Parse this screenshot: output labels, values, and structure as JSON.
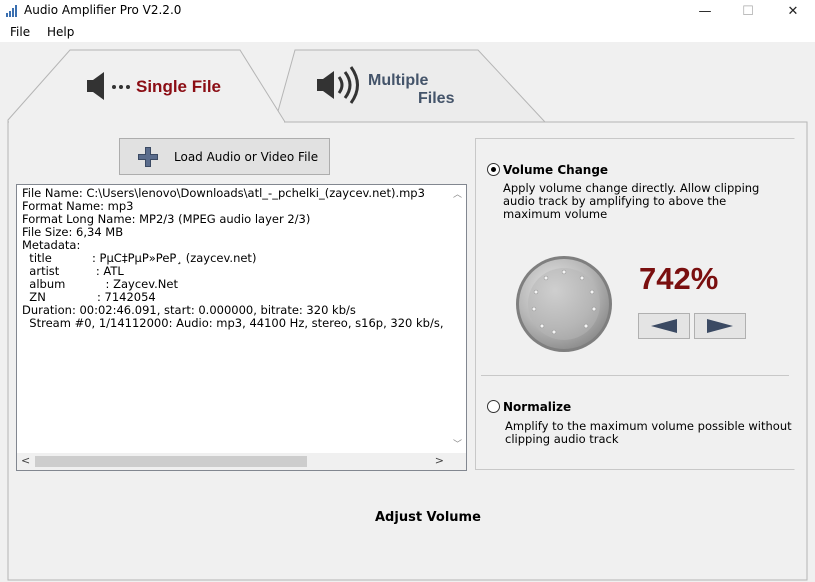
{
  "window": {
    "title": "Audio Amplifier Pro V2.2.0",
    "controls": {
      "minimize": "—",
      "maximize": "☐",
      "close": "✕"
    }
  },
  "menu": {
    "file": "File",
    "help": "Help"
  },
  "tabs": {
    "single": {
      "label": "Single File",
      "icon": "speaker-icon",
      "selected": true
    },
    "multiple": {
      "label_line1": "Multiple",
      "label_line2": "Files",
      "icon": "speaker-loud-icon"
    }
  },
  "load_button": {
    "label": "Load Audio or Video File",
    "icon": "plus-icon"
  },
  "file_info": {
    "lines": [
      "File Name: C:\\Users\\lenovo\\Downloads\\atl_-_pchelki_(zaycev.net).mp3",
      "Format Name: mp3",
      "Format Long Name: MP2/3 (MPEG audio layer 2/3)",
      "File Size: 6,34 MB",
      "Metadata:",
      "  title           : PµC‡PµP»PeP¸ (zaycev.net)",
      "  artist          : ATL",
      "  album           : Zaycev.Net",
      "  ZN              : 7142054",
      "Duration: 00:02:46.091, start: 0.000000, bitrate: 320 kb/s",
      "  Stream #0, 1/14112000: Audio: mp3, 44100 Hz, stereo, s16p, 320 kb/s,"
    ]
  },
  "volume_change": {
    "title": "Volume Change",
    "description_lines": [
      "Apply volume change directly. Allow clipping",
      "audio track by amplifying to above the",
      "maximum volume"
    ],
    "value": "742%",
    "selected": true,
    "decrease_icon": "arrow-left-icon",
    "increase_icon": "arrow-right-icon"
  },
  "normalize": {
    "title": "Normalize",
    "description_lines": [
      "Amplify to the maximum volume possible without",
      "clipping audio track"
    ],
    "selected": false
  },
  "footer": {
    "adjust_label": "Adjust Volume"
  },
  "colors": {
    "accent_red": "#7a0f0f",
    "tab_red": "#8b0d14",
    "tab_blue": "#44546a"
  }
}
